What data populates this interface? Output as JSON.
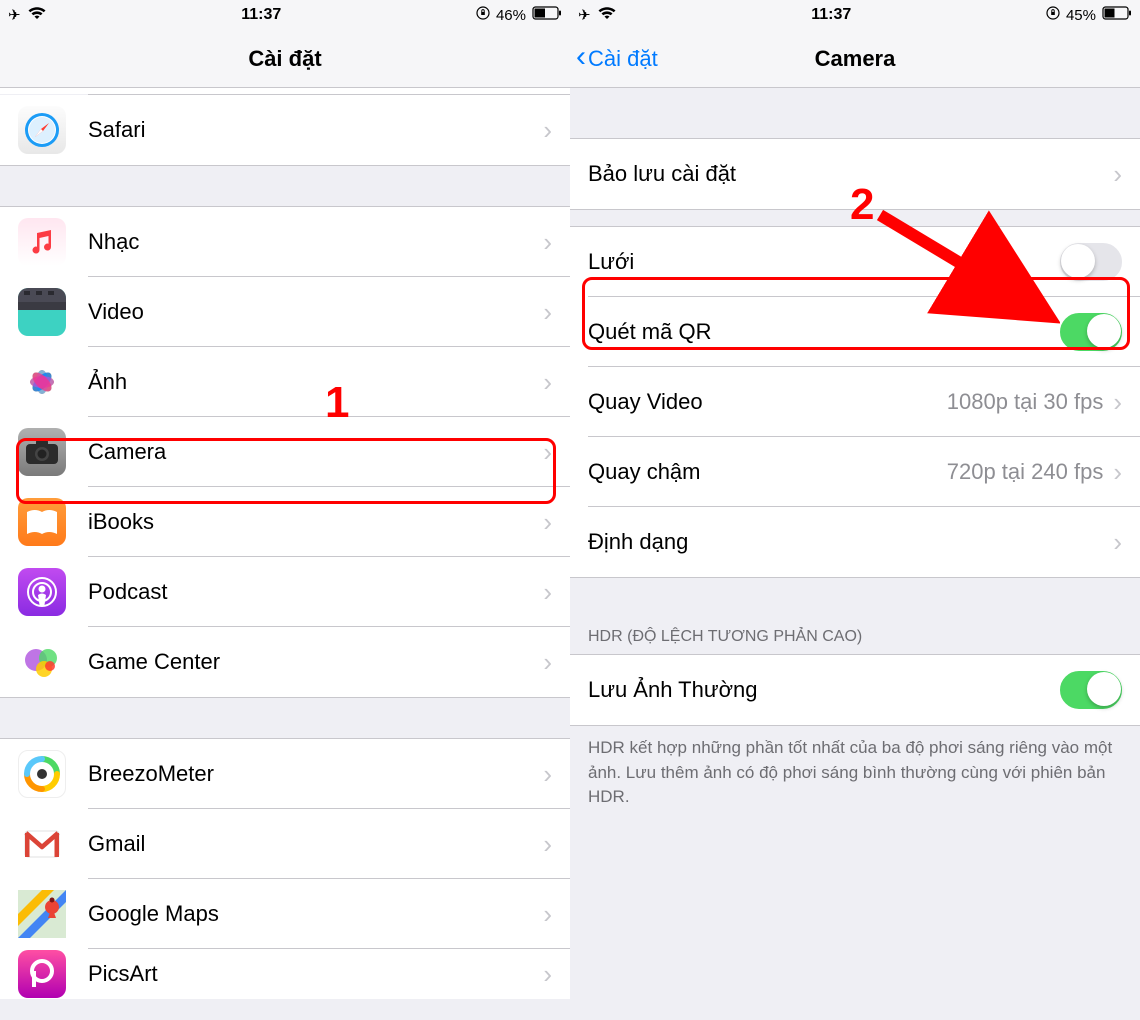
{
  "left": {
    "status": {
      "time": "11:37",
      "battery": "46%"
    },
    "title": "Cài đặt",
    "groups": [
      {
        "items": [
          {
            "key": "safari",
            "label": "Safari"
          }
        ]
      },
      {
        "items": [
          {
            "key": "music",
            "label": "Nhạc"
          },
          {
            "key": "video",
            "label": "Video"
          },
          {
            "key": "photos",
            "label": "Ảnh"
          },
          {
            "key": "camera",
            "label": "Camera"
          },
          {
            "key": "ibooks",
            "label": "iBooks"
          },
          {
            "key": "podcast",
            "label": "Podcast"
          },
          {
            "key": "gamecenter",
            "label": "Game Center"
          }
        ]
      },
      {
        "items": [
          {
            "key": "breezometer",
            "label": "BreezoMeter"
          },
          {
            "key": "gmail",
            "label": "Gmail"
          },
          {
            "key": "googlemaps",
            "label": "Google Maps"
          },
          {
            "key": "picsart",
            "label": "PicsArt"
          }
        ]
      }
    ]
  },
  "right": {
    "status": {
      "time": "11:37",
      "battery": "45%"
    },
    "back": "Cài đặt",
    "title": "Camera",
    "rows": {
      "preserve": {
        "label": "Bảo lưu cài đặt"
      },
      "grid": {
        "label": "Lưới",
        "on": false
      },
      "qr": {
        "label": "Quét mã QR",
        "on": true
      },
      "record": {
        "label": "Quay Video",
        "detail": "1080p tại 30 fps"
      },
      "slomo": {
        "label": "Quay chậm",
        "detail": "720p tại 240 fps"
      },
      "formats": {
        "label": "Định dạng"
      },
      "hdr_header": "HDR (ĐỘ LỆCH TƯƠNG PHẢN CAO)",
      "keepnormal": {
        "label": "Lưu Ảnh Thường",
        "on": true
      },
      "hdr_footer": "HDR kết hợp những phần tốt nhất của ba độ phơi sáng riêng vào một ảnh. Lưu thêm ảnh có độ phơi sáng bình thường cùng với phiên bản HDR."
    }
  },
  "annotations": {
    "n1": "1",
    "n2": "2"
  }
}
